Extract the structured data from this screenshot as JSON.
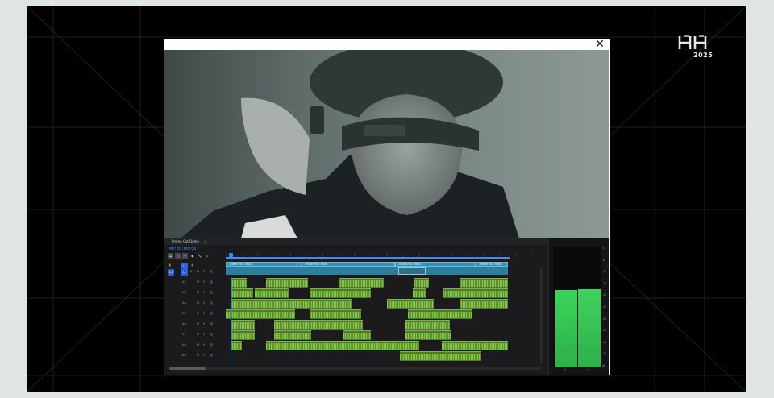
{
  "logo": {
    "mark": "HH",
    "year": "2025"
  },
  "modal": {
    "close_label": "✕"
  },
  "timeline": {
    "sequence_name": "Promo Cut Demo",
    "tab_close": "≡",
    "timecode": "00:00:00:00",
    "clip_label": "Teaser HD .mp4",
    "video_tracks": [
      {
        "target": "V1",
        "source": "V1"
      }
    ],
    "audio_tracks": [
      {
        "source": "A1",
        "target": "A1",
        "label": "A1"
      },
      {
        "label": "A2"
      },
      {
        "label": "A3"
      },
      {
        "label": "A4"
      },
      {
        "label": "A5"
      },
      {
        "label": "A6"
      },
      {
        "label": "A7"
      },
      {
        "label": "A8"
      },
      {
        "label": "A9"
      }
    ],
    "track_icons": {
      "sync": "6",
      "mute": "M",
      "solo": "S",
      "mic": "🎙"
    }
  },
  "meters": {
    "levels": {
      "left": 0.64,
      "right": 0.65
    },
    "scale": [
      "0",
      "-6",
      "-12",
      "-18",
      "-24",
      "-30",
      "-36",
      "-42",
      "-48",
      "-54",
      "dB"
    ],
    "channel_labels": [
      "S",
      "S"
    ],
    "color": "#3cd45a"
  },
  "colors": {
    "accent": "#3d8cff",
    "video_clip": "#3a8fb5",
    "audio_clip": "#4f7a2c"
  }
}
